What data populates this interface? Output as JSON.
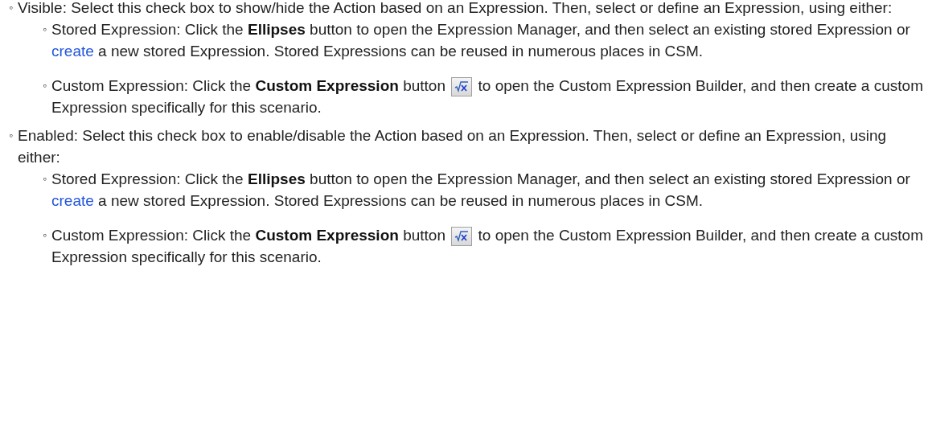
{
  "items": [
    {
      "bullet": "◦",
      "parts": [
        {
          "kind": "text",
          "text": "Visible: Select this check box to show/hide the Action based on an Expression. Then, select or define an Expression, using either:"
        }
      ],
      "children": [
        {
          "bullet": "◦",
          "parts": [
            {
              "kind": "text",
              "text": "Stored Expression: Click the **Ellipses** button to open the Expression Manager, and then select an existing stored Expression or "
            },
            {
              "kind": "link",
              "text": "create"
            },
            {
              "kind": "text",
              "text": " a new stored Expression. Stored Expressions can be reused in numerous places in CSM."
            }
          ]
        },
        {
          "bullet": "◦",
          "parts": [
            {
              "kind": "text",
              "text": "Custom Expression: Click the **Custom Expression** button "
            },
            {
              "kind": "icon"
            },
            {
              "kind": "text",
              "text": " to open the Custom Expression Builder, and then create a custom Expression specifically for this scenario."
            }
          ]
        }
      ]
    },
    {
      "bullet": "◦",
      "parts": [
        {
          "kind": "text",
          "text": "Enabled: Select this check box to enable/disable the Action based on an Expression. Then, select or define an Expression, using either:"
        }
      ],
      "children": [
        {
          "bullet": "◦",
          "parts": [
            {
              "kind": "text",
              "text": "Stored Expression: Click the **Ellipses** button to open the Expression Manager, and then select an existing stored Expression or "
            },
            {
              "kind": "link",
              "text": "create"
            },
            {
              "kind": "text",
              "text": " a new stored Expression. Stored Expressions can be reused in numerous places in CSM."
            }
          ]
        },
        {
          "bullet": "◦",
          "parts": [
            {
              "kind": "text",
              "text": "Custom Expression: Click the **Custom Expression** button "
            },
            {
              "kind": "icon"
            },
            {
              "kind": "text",
              "text": " to open the Custom Expression Builder, and then create a custom Expression specifically for this scenario."
            }
          ]
        }
      ]
    }
  ]
}
